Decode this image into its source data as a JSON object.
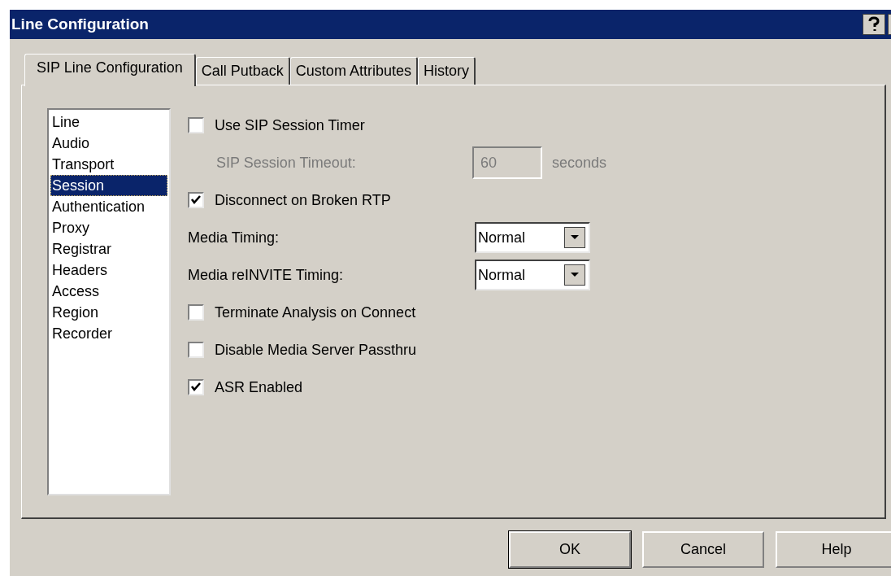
{
  "window": {
    "title": "Line Configuration"
  },
  "tabs": [
    {
      "label": "SIP Line Configuration",
      "selected": true
    },
    {
      "label": "Call Putback",
      "selected": false
    },
    {
      "label": "Custom Attributes",
      "selected": false
    },
    {
      "label": "History",
      "selected": false
    }
  ],
  "sidebar": {
    "items": [
      {
        "label": "Line",
        "selected": false
      },
      {
        "label": "Audio",
        "selected": false
      },
      {
        "label": "Transport",
        "selected": false
      },
      {
        "label": "Session",
        "selected": true
      },
      {
        "label": "Authentication",
        "selected": false
      },
      {
        "label": "Proxy",
        "selected": false
      },
      {
        "label": "Registrar",
        "selected": false
      },
      {
        "label": "Headers",
        "selected": false
      },
      {
        "label": "Access",
        "selected": false
      },
      {
        "label": "Region",
        "selected": false
      },
      {
        "label": "Recorder",
        "selected": false
      }
    ]
  },
  "settings": [
    {
      "kind": "checkbox",
      "label": "Use SIP Session Timer",
      "checked": false
    },
    {
      "kind": "field",
      "label": "SIP Session Timeout:",
      "value": "60",
      "unit": "seconds",
      "disabled": true
    },
    {
      "kind": "checkbox",
      "label": "Disconnect on Broken RTP",
      "checked": true
    },
    {
      "kind": "select",
      "label": "Media Timing:",
      "value": "Normal"
    },
    {
      "kind": "select",
      "label": "Media reINVITE Timing:",
      "value": "Normal"
    },
    {
      "kind": "checkbox",
      "label": "Terminate Analysis on Connect",
      "checked": false
    },
    {
      "kind": "checkbox",
      "label": "Disable Media Server Passthru",
      "checked": false
    },
    {
      "kind": "checkbox",
      "label": "ASR Enabled",
      "checked": true
    }
  ],
  "buttons": [
    {
      "label": "OK",
      "default": true
    },
    {
      "label": "Cancel",
      "default": false
    },
    {
      "label": "Help",
      "default": false
    }
  ]
}
